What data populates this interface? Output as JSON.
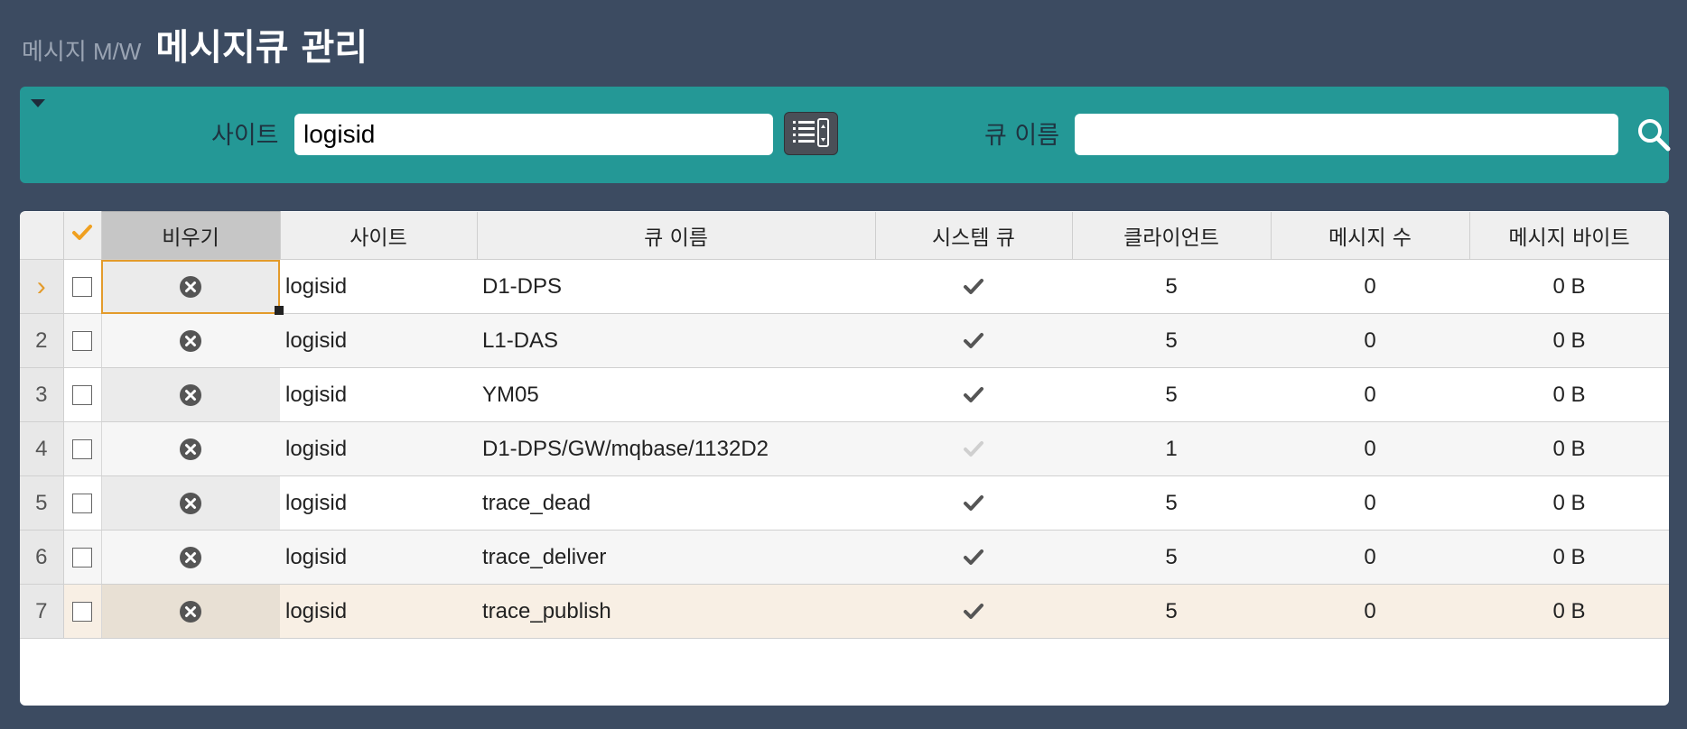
{
  "header": {
    "breadcrumb": "메시지 M/W",
    "title": "메시지큐 관리"
  },
  "search": {
    "site_label": "사이트",
    "site_value": "logisid",
    "queue_label": "큐 이름",
    "queue_value": ""
  },
  "grid": {
    "columns": [
      "비우기",
      "사이트",
      "큐 이름",
      "시스템 큐",
      "클라이언트",
      "메시지 수",
      "메시지 바이트"
    ],
    "rows": [
      {
        "num": "›",
        "site": "logisid",
        "queue": "D1-DPS",
        "system": true,
        "clients": "5",
        "messages": "0",
        "bytes": "0 B"
      },
      {
        "num": "2",
        "site": "logisid",
        "queue": "L1-DAS",
        "system": true,
        "clients": "5",
        "messages": "0",
        "bytes": "0 B"
      },
      {
        "num": "3",
        "site": "logisid",
        "queue": "YM05",
        "system": true,
        "clients": "5",
        "messages": "0",
        "bytes": "0 B"
      },
      {
        "num": "4",
        "site": "logisid",
        "queue": "D1-DPS/GW/mqbase/1132D2",
        "system": false,
        "clients": "1",
        "messages": "0",
        "bytes": "0 B"
      },
      {
        "num": "5",
        "site": "logisid",
        "queue": "trace_dead",
        "system": true,
        "clients": "5",
        "messages": "0",
        "bytes": "0 B"
      },
      {
        "num": "6",
        "site": "logisid",
        "queue": "trace_deliver",
        "system": true,
        "clients": "5",
        "messages": "0",
        "bytes": "0 B"
      },
      {
        "num": "7",
        "site": "logisid",
        "queue": "trace_publish",
        "system": true,
        "clients": "5",
        "messages": "0",
        "bytes": "0 B"
      }
    ]
  },
  "colors": {
    "panel": "#249896",
    "background": "#3c4b61",
    "accent": "#e39b2b"
  },
  "icons": {
    "list": "list-icon",
    "search": "search-icon",
    "clear": "clear-icon",
    "check": "check-icon"
  }
}
